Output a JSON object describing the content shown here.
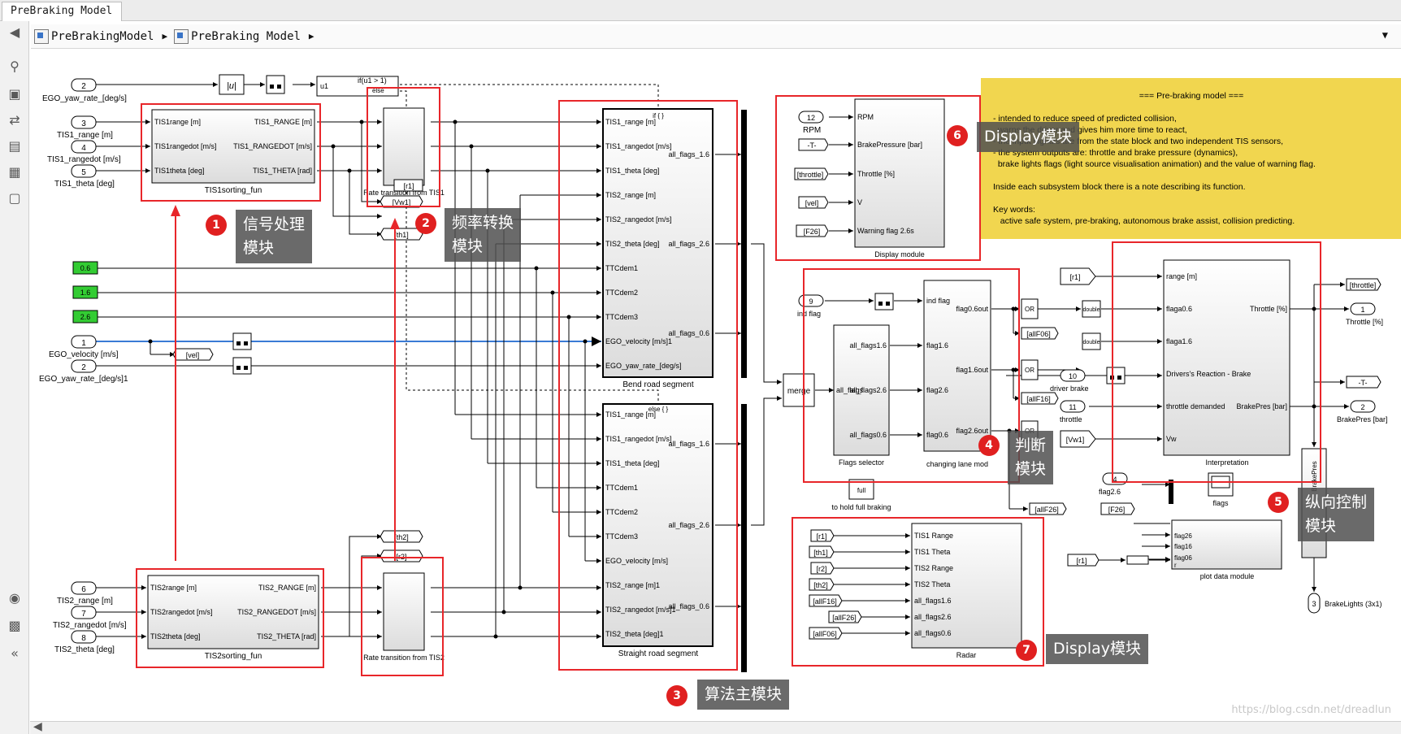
{
  "window": {
    "tab_title": "PreBraking Model"
  },
  "breadcrumb": [
    "PreBrakingModel",
    "PreBraking Model"
  ],
  "toolbar_icons": [
    "back-arrow-icon",
    "zoom-icon",
    "fit-view-icon",
    "arrow-right-icon",
    "annotation-icon",
    "image-icon",
    "area-icon",
    "camera-icon",
    "explorer-icon",
    "collapse-icon"
  ],
  "inports_left": [
    {
      "num": "2",
      "label": "EGO_yaw_rate_[deg/s]"
    },
    {
      "num": "3",
      "label": "TIS1_range [m]"
    },
    {
      "num": "4",
      "label": "TIS1_rangedot [m/s]"
    },
    {
      "num": "5",
      "label": "TIS1_theta [deg]"
    },
    {
      "num": "1",
      "label": "EGO_velocity [m/s]"
    },
    {
      "num": "2",
      "label": "EGO_yaw_rate_[deg/s]1"
    },
    {
      "num": "6",
      "label": "TIS2_range [m]"
    },
    {
      "num": "7",
      "label": "TIS2_rangedot [m/s]"
    },
    {
      "num": "8",
      "label": "TIS2_theta [deg]"
    }
  ],
  "constants": [
    "0.6",
    "1.6",
    "2.6"
  ],
  "abs_block": "|u|",
  "if_block": {
    "input": "u1",
    "cond": "if(u1 > 1)",
    "else": "else"
  },
  "tis1_sorting": {
    "inputs": [
      "TIS1range [m]",
      "TIS1rangedot [m/s]",
      "TIS1theta [deg]"
    ],
    "outputs": [
      "TIS1_RANGE [m]",
      "TIS1_RANGEDOT [m/s]",
      "TIS1_THETA [rad]"
    ],
    "name": "TIS1sorting_fun"
  },
  "tis2_sorting": {
    "inputs": [
      "TIS2range [m]",
      "TIS2rangedot [m/s]",
      "TIS2theta [deg]"
    ],
    "outputs": [
      "TIS2_RANGE [m]",
      "TIS2_RANGEDOT [m/s]",
      "TIS2_THETA [rad]"
    ],
    "name": "TIS2sorting_fun"
  },
  "rate_tis1": "Rate transition from TIS1",
  "rate_tis2": "Rate transition from TIS2",
  "goto_tags": {
    "vw1": "[Vw1]",
    "th1": "[th1]",
    "r1": "[r1]",
    "th2": "[th2]",
    "r2": "[r2]",
    "vel": "[vel]"
  },
  "bend": {
    "header": "if { }",
    "inputs": [
      "TIS1_range [m]",
      "TIS1_rangedot [m/s]",
      "TIS1_theta [deg]",
      "TIS2_range [m]",
      "TIS2_rangedot [m/s]",
      "TIS2_theta [deg]",
      "TTCdem1",
      "TTCdem2",
      "TTCdem3",
      "EGO_velocity [m/s]1",
      "EGO_yaw_rate_[deg/s]"
    ],
    "outputs": [
      "all_flags_1.6",
      "all_flags_2.6",
      "all_flags_0.6"
    ],
    "name": "Bend road segment"
  },
  "straight": {
    "header": "else { }",
    "inputs": [
      "TIS1_range [m]",
      "TIS1_rangedot [m/s]",
      "TIS1_theta [deg]",
      "TTCdem1",
      "TTCdem2",
      "TTCdem3",
      "EGO_velocity [m/s]",
      "TIS2_range [m]1",
      "TIS2_rangedot [m/s]1",
      "TIS2_theta [deg]1"
    ],
    "outputs": [
      "all_flags_1.6",
      "all_flags_2.6",
      "all_flags_0.6"
    ],
    "name": "Straight road segment"
  },
  "merge": "merge",
  "display_module": {
    "inputs": [
      {
        "tag": "12",
        "label": "RPM"
      },
      {
        "tag": "-T-"
      },
      {
        "tag": "[throttle]"
      },
      {
        "tag": "[vel]"
      },
      {
        "tag": "[F26]"
      }
    ],
    "ports": [
      "RPM",
      "BrakePressure [bar]",
      "Throttle [%]",
      "V",
      "Warning flag 2.6s"
    ],
    "name": "Display module"
  },
  "note": {
    "title": "=== Pre-braking model ===",
    "lines": [
      "- intended to reduce speed of predicted collision,",
      "  warns the driver and gives him more time to react,",
      "- the input signals are from the state block and two independent TIS sensors,",
      "- the system outputs are: throttle and brake pressure (dynamics),",
      "  brake lights flags (light source visualisation animation) and the value of warning flag.",
      "",
      "Inside each subsystem block there is a note describing its function.",
      "",
      "Key words:",
      "   active safe system, pre-braking, autonomous brake assist, collision predicting."
    ]
  },
  "flags_selector": {
    "ports": [
      "all_flags1.6",
      "all_flags2.6",
      "all_flags0.6"
    ],
    "out": "all_flags",
    "name": "Flags selector",
    "inport": {
      "num": "9",
      "label": "ind flag"
    }
  },
  "changing_lane": {
    "inputs": [
      "ind flag",
      "flag1.6",
      "flag2.6",
      "flag0.6"
    ],
    "outputs": [
      "flag0.6out",
      "flag1.6out",
      "flag2.6out"
    ],
    "name": "changing lane mod"
  },
  "or_label": "OR",
  "double_label": "double",
  "tags_mid": [
    "[allF06]",
    "[allF16]",
    "[allF26]",
    "[F26]",
    "[Vw1]"
  ],
  "full_braking": {
    "label": "full",
    "name": "to hold full braking"
  },
  "interpretation": {
    "inputs": [
      "range [m]",
      "flaga0.6",
      "flaga1.6",
      "Drivers's Reaction - Brake",
      "throttle demanded",
      "Vw"
    ],
    "outputs": [
      "Throttle [%]",
      "BrakePres [bar]"
    ],
    "name": "Interpretation",
    "ext_inputs": [
      {
        "num": "10",
        "label": "driver brake"
      },
      {
        "num": "11",
        "label": "throttle"
      }
    ]
  },
  "out_ports": [
    {
      "num": "1",
      "label": "Throttle [%]"
    },
    {
      "num": "2",
      "label": "BrakePres [bar]"
    },
    {
      "num": "3",
      "label": "BrakeLights (3x1)"
    },
    {
      "num": "4",
      "label": "flag2.6"
    }
  ],
  "out_tags": [
    "[throttle]",
    "-T-",
    "[F26]"
  ],
  "brake_light_block": "BrakePres",
  "flags_scope": "flags",
  "plot_module": {
    "ports": [
      "flag26",
      "flag16",
      "flag06",
      "r"
    ],
    "name": "plot data module"
  },
  "radar": {
    "tags": [
      "[r1]",
      "[th1]",
      "[r2]",
      "[th2]",
      "[allF16]",
      "[allF26]",
      "[allF06]"
    ],
    "ports": [
      "TIS1 Range",
      "TIS1 Theta",
      "TIS2 Range",
      "TIS2 Theta",
      "all_flags1.6",
      "all_flags2.6",
      "all_flags0.6"
    ],
    "name": "Radar"
  },
  "annotations": [
    {
      "n": "1",
      "text": "信号处理\n模块"
    },
    {
      "n": "2",
      "text": "频率转换\n模块"
    },
    {
      "n": "3",
      "text": "算法主模块"
    },
    {
      "n": "4",
      "text": "判断\n模块"
    },
    {
      "n": "5",
      "text": "纵向控制\n模块"
    },
    {
      "n": "6",
      "text": "Display模块"
    },
    {
      "n": "7",
      "text": "Display模块"
    }
  ],
  "colors": {
    "highlight": "#e8262a",
    "note_bg": "#f1d64f",
    "const_green": "#33cc33",
    "ann_bg": "#555555"
  },
  "watermark": "https://blog.csdn.net/dreadlun"
}
